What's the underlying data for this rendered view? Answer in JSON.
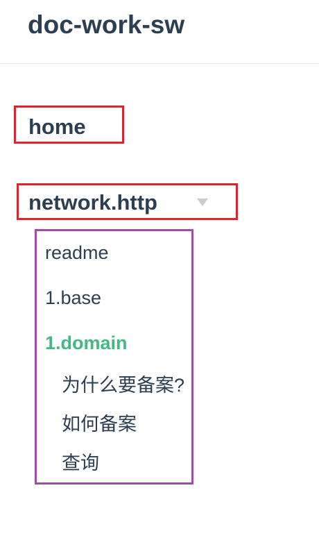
{
  "header": {
    "title": "doc-work-sw"
  },
  "nav": {
    "home": "home",
    "section": "network.http",
    "items": [
      {
        "label": "readme"
      },
      {
        "label": "1.base"
      },
      {
        "label": "1.domain"
      },
      {
        "label": "为什么要备案?"
      },
      {
        "label": "如何备案"
      },
      {
        "label": "查询"
      }
    ]
  },
  "colors": {
    "text": "#2c3e50",
    "active": "#42b983",
    "highlight_red": "#d9252f",
    "highlight_purple": "#9b4fa5"
  },
  "icons": {
    "expand": "caret-down-icon"
  }
}
